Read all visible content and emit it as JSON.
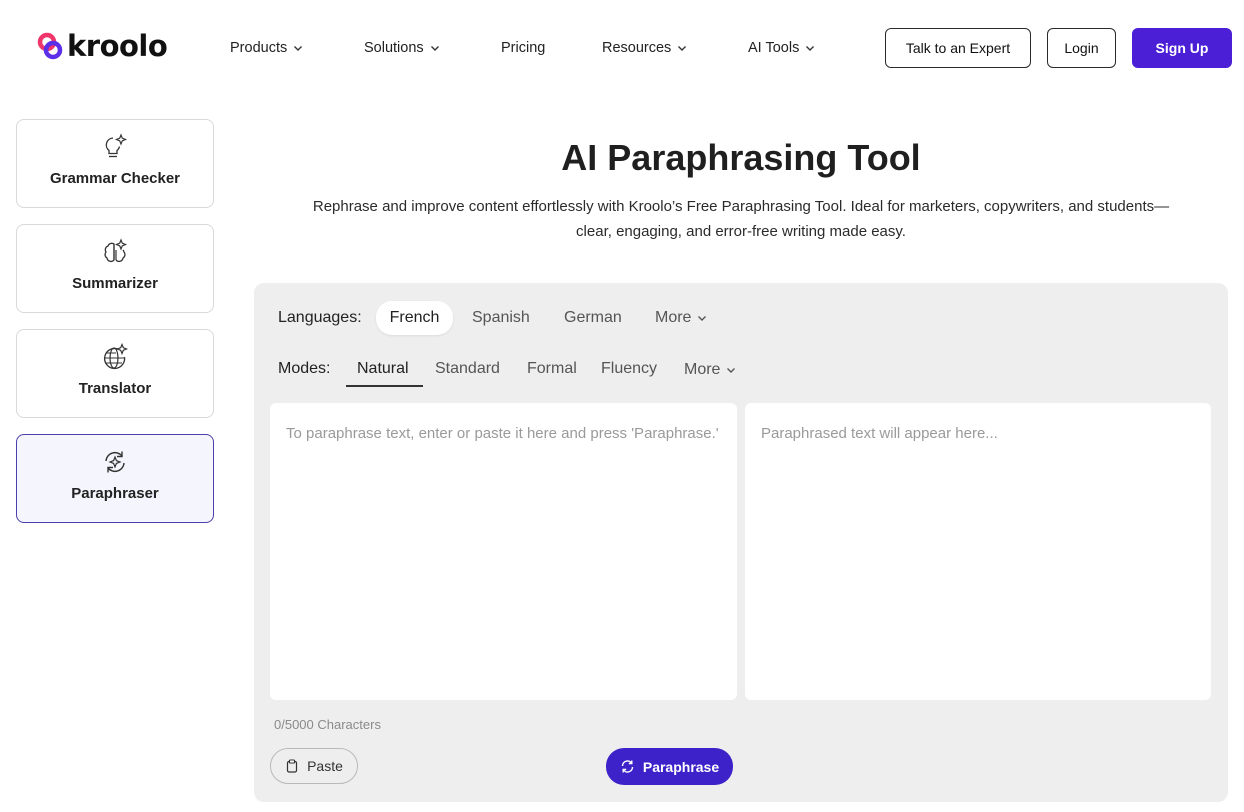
{
  "header": {
    "logo_text": "kroolo",
    "nav": [
      {
        "label": "Products",
        "dropdown": true
      },
      {
        "label": "Solutions",
        "dropdown": true
      },
      {
        "label": "Pricing",
        "dropdown": false
      },
      {
        "label": "Resources",
        "dropdown": true
      },
      {
        "label": "AI Tools",
        "dropdown": true
      }
    ],
    "talk_label": "Talk to an Expert",
    "login_label": "Login",
    "signup_label": "Sign Up"
  },
  "sidebar": {
    "items": [
      {
        "label": "Grammar Checker",
        "icon": "lightbulb-sparkle-icon",
        "active": false
      },
      {
        "label": "Summarizer",
        "icon": "brain-sparkle-icon",
        "active": false
      },
      {
        "label": "Translator",
        "icon": "globe-sparkle-icon",
        "active": false
      },
      {
        "label": "Paraphraser",
        "icon": "refresh-sparkle-icon",
        "active": true
      }
    ]
  },
  "main": {
    "title": "AI Paraphrasing Tool",
    "subtitle": "Rephrase and improve content effortlessly with Kroolo’s Free Paraphrasing Tool. Ideal for marketers, copywriters, and students—clear, engaging, and error-free writing made easy."
  },
  "tool": {
    "languages_label": "Languages:",
    "languages": [
      "French",
      "Spanish",
      "German"
    ],
    "selected_language": "French",
    "languages_more": "More",
    "modes_label": "Modes:",
    "modes": [
      "Natural",
      "Standard",
      "Formal",
      "Fluency"
    ],
    "selected_mode": "Natural",
    "modes_more": "More",
    "input_placeholder": "To paraphrase text, enter or paste it here and press 'Paraphrase.'",
    "output_placeholder": "Paraphrased text will appear here...",
    "char_count": "0/5000 Characters",
    "paste_label": "Paste",
    "paraphrase_label": "Paraphrase"
  },
  "colors": {
    "brand": "#4a1fd6",
    "paraphrase_button": "#3d22c9",
    "panel_bg": "#eeeeee",
    "active_card_border": "#4a3fae"
  }
}
